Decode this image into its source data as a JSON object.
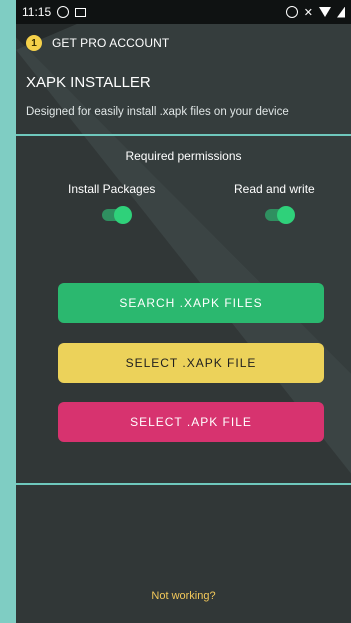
{
  "status_bar": {
    "time": "11:15",
    "whatsapp_icon": "whatsapp-icon",
    "mail_icon": "mail-icon",
    "alarm_icon": "alarm-icon",
    "mute_icon": "mute-icon",
    "wifi_icon": "wifi-icon",
    "signal_icon": "signal-icon"
  },
  "header": {
    "pro_label": "GET PRO ACCOUNT",
    "pro_icon_text": "1"
  },
  "app": {
    "title": "XAPK INSTALLER",
    "subtitle": "Designed for easily install .xapk files on your device"
  },
  "permissions": {
    "title": "Required permissions",
    "items": [
      {
        "label": "Install Packages",
        "enabled": true
      },
      {
        "label": "Read and write",
        "enabled": true
      }
    ]
  },
  "actions": {
    "search": "SEARCH .XAPK FILES",
    "select_xapk": "SELECT .XAPK FILE",
    "select_apk": "SELECT .APK FILE"
  },
  "footer": {
    "help_link": "Not working?"
  },
  "colors": {
    "accent_teal": "#6fc8bd",
    "green": "#2bb86f",
    "yellow": "#ecd25a",
    "pink": "#d7336f",
    "link": "#f2c85a"
  }
}
